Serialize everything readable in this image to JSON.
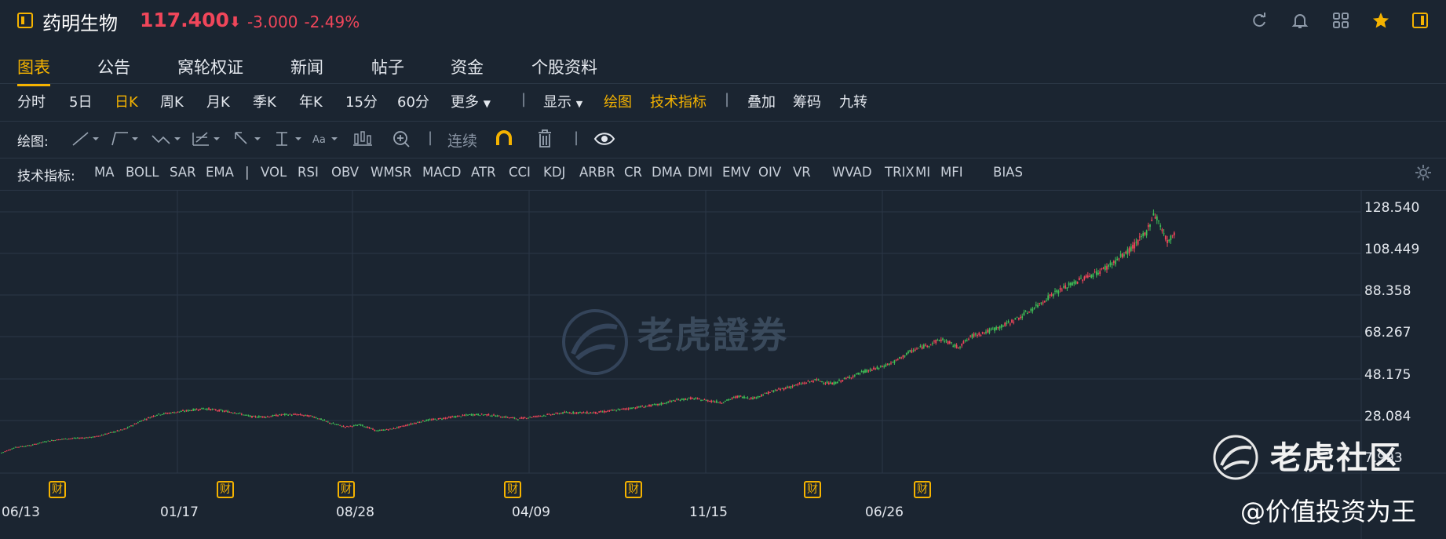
{
  "header": {
    "stock_name": "药明生物",
    "price": "117.400",
    "change": "-3.000",
    "change_pct": "-2.49%",
    "down_arrow": "⬇",
    "icons": [
      "refresh-icon",
      "bell-icon",
      "grid-icon",
      "star-icon",
      "panel-icon"
    ]
  },
  "tabs": [
    "图表",
    "公告",
    "窝轮权证",
    "新闻",
    "帖子",
    "资金",
    "个股资料"
  ],
  "periods": {
    "items": [
      "分时",
      "5日",
      "日K",
      "周K",
      "月K",
      "季K",
      "年K",
      "15分",
      "60分",
      "更多"
    ],
    "active": "日K",
    "display": "显示",
    "draw": "绘图",
    "tech": "技术指标",
    "overlay": "叠加",
    "chips": "筹码",
    "nine": "九转"
  },
  "drawbar": {
    "label": "绘图:",
    "continuous": "连续",
    "tools": [
      "line-tool-icon",
      "trendline-tool-icon",
      "wave-tool-icon",
      "fib-tool-icon",
      "arrow-tool-icon",
      "measure-tool-icon",
      "text-tool-icon",
      "candle-tool-icon",
      "zoom-in-icon",
      "magnet-icon",
      "trash-icon",
      "eye-icon"
    ]
  },
  "indicators": {
    "label": "技术指标:",
    "items": [
      "MA",
      "BOLL",
      "SAR",
      "EMA",
      "|",
      "VOL",
      "RSI",
      "OBV",
      "WMSR",
      "MACD",
      "ATR",
      "CCI",
      "KDJ",
      "ARBR",
      "CR",
      "DMA",
      "DMI",
      "EMV",
      "OIV",
      "VR",
      "WVAD",
      "TRIX",
      "MI",
      "MFI",
      "BIAS"
    ]
  },
  "chart_data": {
    "type": "candlestick",
    "y_ticks": [
      "128.540",
      "108.449",
      "88.358",
      "68.267",
      "48.175",
      "28.084",
      "7.993"
    ],
    "ylim": [
      7.993,
      128.54
    ],
    "x_ticks": [
      "06/13",
      "01/17",
      "08/28",
      "04/09",
      "11/15",
      "06/26"
    ],
    "earnings_markers": [
      "财",
      "财",
      "财",
      "财",
      "财",
      "财",
      "财"
    ],
    "trend": [
      [
        0,
        10
      ],
      [
        20,
        13
      ],
      [
        40,
        14
      ],
      [
        60,
        16
      ],
      [
        80,
        17
      ],
      [
        100,
        17.5
      ],
      [
        120,
        18
      ],
      [
        140,
        20
      ],
      [
        160,
        22
      ],
      [
        180,
        26
      ],
      [
        200,
        29
      ],
      [
        220,
        30
      ],
      [
        240,
        31
      ],
      [
        260,
        32
      ],
      [
        280,
        31
      ],
      [
        300,
        30
      ],
      [
        320,
        28
      ],
      [
        340,
        28
      ],
      [
        360,
        29
      ],
      [
        380,
        29
      ],
      [
        400,
        28
      ],
      [
        420,
        25
      ],
      [
        440,
        23
      ],
      [
        460,
        24
      ],
      [
        480,
        21
      ],
      [
        500,
        22
      ],
      [
        520,
        24
      ],
      [
        540,
        26
      ],
      [
        560,
        27
      ],
      [
        580,
        28
      ],
      [
        600,
        29
      ],
      [
        620,
        29
      ],
      [
        640,
        28
      ],
      [
        660,
        27
      ],
      [
        680,
        28
      ],
      [
        700,
        29
      ],
      [
        720,
        30
      ],
      [
        740,
        30
      ],
      [
        760,
        30
      ],
      [
        780,
        31
      ],
      [
        800,
        32
      ],
      [
        820,
        33
      ],
      [
        840,
        34
      ],
      [
        860,
        36
      ],
      [
        880,
        37
      ],
      [
        900,
        36
      ],
      [
        920,
        35
      ],
      [
        940,
        38
      ],
      [
        960,
        37
      ],
      [
        980,
        40
      ],
      [
        1000,
        42
      ],
      [
        1020,
        44
      ],
      [
        1040,
        46
      ],
      [
        1060,
        44
      ],
      [
        1080,
        47
      ],
      [
        1100,
        50
      ],
      [
        1120,
        52
      ],
      [
        1140,
        55
      ],
      [
        1160,
        60
      ],
      [
        1180,
        63
      ],
      [
        1200,
        66
      ],
      [
        1220,
        62
      ],
      [
        1240,
        68
      ],
      [
        1260,
        70
      ],
      [
        1280,
        73
      ],
      [
        1300,
        77
      ],
      [
        1320,
        82
      ],
      [
        1340,
        88
      ],
      [
        1360,
        92
      ],
      [
        1380,
        96
      ],
      [
        1400,
        99
      ],
      [
        1420,
        104
      ],
      [
        1440,
        110
      ],
      [
        1460,
        118
      ],
      [
        1470,
        128
      ],
      [
        1478,
        122
      ],
      [
        1488,
        113
      ],
      [
        1498,
        120
      ]
    ],
    "last_price": 117.4,
    "colors": {
      "up": "#3fbf56",
      "down": "#f0465a",
      "grid": "#2b3746"
    }
  },
  "watermarks": {
    "center": "老虎證券",
    "corner": "老虎社区",
    "author": "@价值投资为王"
  }
}
